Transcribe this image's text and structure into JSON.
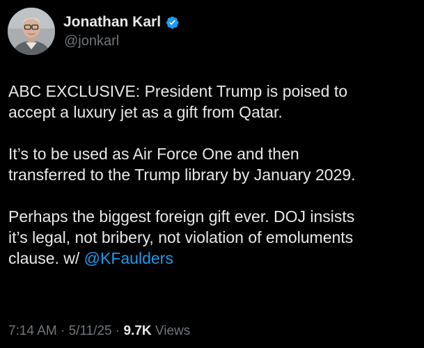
{
  "author": {
    "display_name": "Jonathan Karl",
    "handle": "@jonkarl",
    "verified_icon": "verified-badge-icon",
    "badge_color": "#1d9bf0"
  },
  "tweet": {
    "paragraph_1": "ABC EXCLUSIVE: President Trump is poised to\naccept a luxury jet as a gift from Qatar.",
    "paragraph_2": "It’s to be used as Air Force One and then\ntransferred to the Trump library by January 2029.",
    "paragraph_3_text": "Perhaps the biggest foreign gift ever. DOJ insists\nit’s legal, not bribery, not violation of emoluments\nclause. w/ ",
    "mention": "@KFaulders"
  },
  "meta": {
    "time": "7:14 AM",
    "separator": "·",
    "date": "5/11/25",
    "views_count": "9.7K",
    "views_label": "Views"
  },
  "colors": {
    "background": "#000000",
    "text": "#e7e9ea",
    "secondary": "#71767b",
    "link": "#1d9bf0"
  }
}
